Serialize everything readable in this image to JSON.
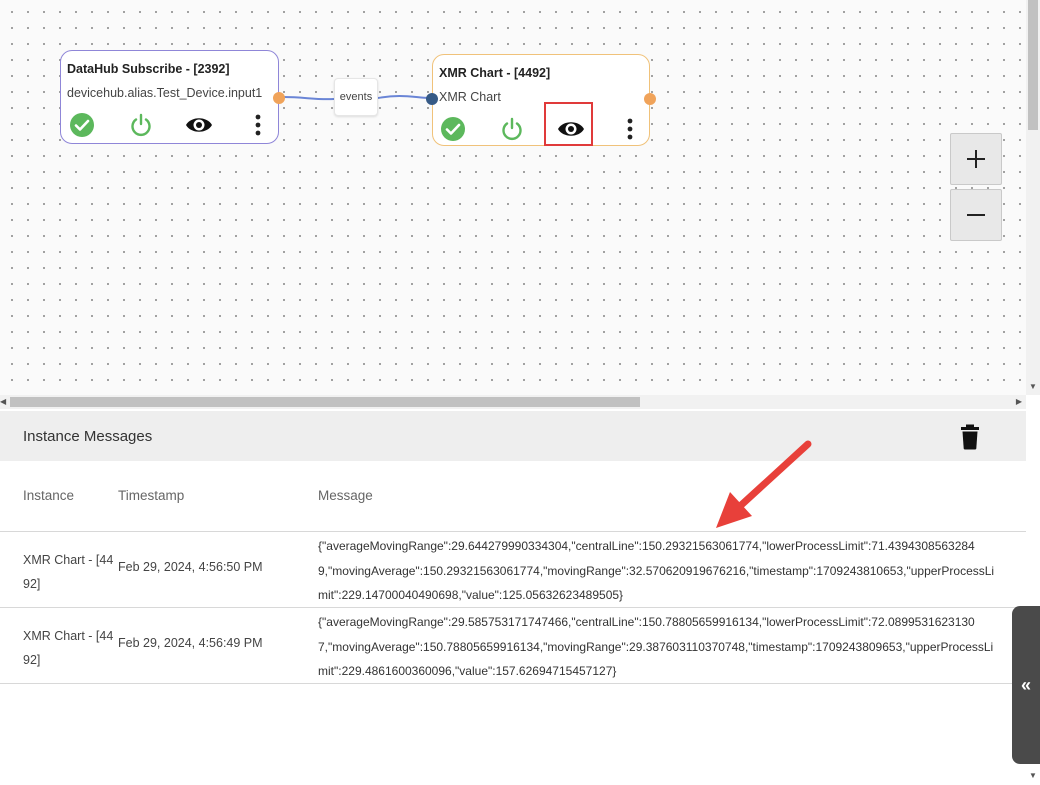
{
  "canvas": {
    "nodes": [
      {
        "title": "DataHub Subscribe - [2392]",
        "subtitle": "devicehub.alias.Test_Device.input1"
      },
      {
        "title": "XMR Chart - [4492]",
        "subtitle": "XMR Chart"
      }
    ],
    "edge_label": "events",
    "zoom_in": "+",
    "zoom_out": "−"
  },
  "panel": {
    "title": "Instance Messages",
    "columns": {
      "instance": "Instance",
      "timestamp": "Timestamp",
      "message": "Message"
    },
    "rows": [
      {
        "instance": "XMR Chart - [4492]",
        "timestamp": "Feb 29, 2024, 4:56:50 PM",
        "message": "{\"averageMovingRange\":29.644279990334304,\"centralLine\":150.29321563061774,\"lowerProcessLimit\":71.43943085632849,\"movingAverage\":150.29321563061774,\"movingRange\":32.570620919676216,\"timestamp\":1709243810653,\"upperProcessLimit\":229.14700040490698,\"value\":125.05632623489505}"
      },
      {
        "instance": "XMR Chart - [4492]",
        "timestamp": "Feb 29, 2024, 4:56:49 PM",
        "message": "{\"averageMovingRange\":29.585753171747466,\"centralLine\":150.78805659916134,\"lowerProcessLimit\":72.08995316231307,\"movingAverage\":150.78805659916134,\"movingRange\":29.387603110370748,\"timestamp\":1709243809653,\"upperProcessLimit\":229.4861600360096,\"value\":157.62694715457127}"
      }
    ]
  },
  "side_tab": "«",
  "colors": {
    "check": "#5cb85c",
    "power": "#5cb85c",
    "highlight": "#e03a3a",
    "edge": "#6a85d6",
    "arrow": "#e8403a"
  }
}
